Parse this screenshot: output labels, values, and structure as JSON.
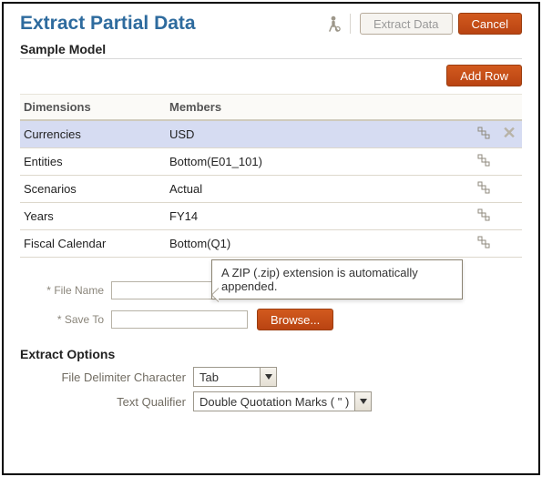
{
  "header": {
    "title": "Extract Partial Data",
    "extract_label": "Extract Data",
    "cancel_label": "Cancel"
  },
  "sample": {
    "title": "Sample Model",
    "add_row_label": "Add Row",
    "columns": {
      "dim": "Dimensions",
      "mem": "Members"
    },
    "rows": [
      {
        "dim": "Currencies",
        "mem": "USD",
        "selected": true,
        "removable": true
      },
      {
        "dim": "Entities",
        "mem": "Bottom(E01_101)",
        "selected": false,
        "removable": false
      },
      {
        "dim": "Scenarios",
        "mem": "Actual",
        "selected": false,
        "removable": false
      },
      {
        "dim": "Years",
        "mem": "FY14",
        "selected": false,
        "removable": false
      },
      {
        "dim": "Fiscal Calendar",
        "mem": "Bottom(Q1)",
        "selected": false,
        "removable": false
      }
    ]
  },
  "form": {
    "file_name_label": "File Name",
    "file_name_value": "",
    "save_to_label": "Save To",
    "save_to_value": "",
    "browse_label": "Browse...",
    "tooltip": "A ZIP (.zip) extension is automatically appended."
  },
  "options": {
    "title": "Extract Options",
    "delimiter_label": "File Delimiter Character",
    "delimiter_value": "Tab",
    "qualifier_label": "Text Qualifier",
    "qualifier_value": "Double Quotation Marks ( \" )"
  }
}
